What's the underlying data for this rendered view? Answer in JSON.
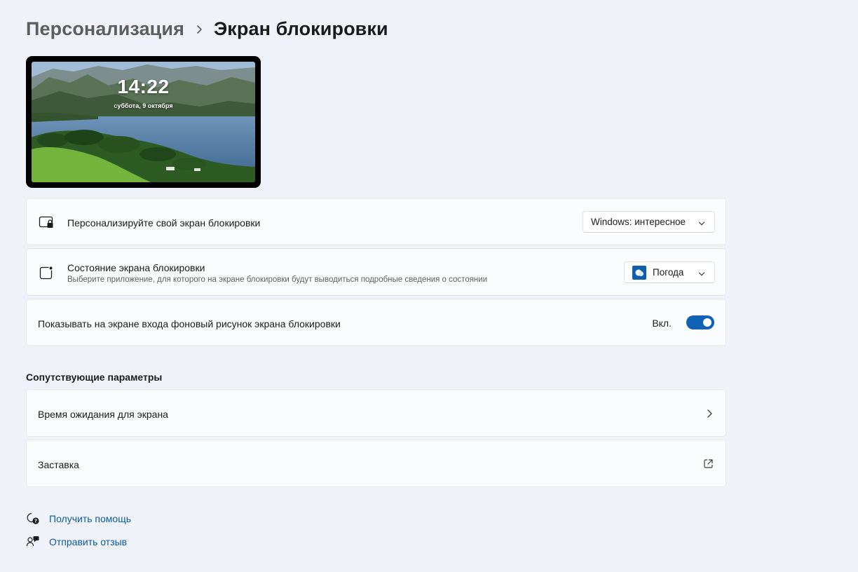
{
  "breadcrumb": {
    "parent": "Персонализация",
    "separator_icon": "chevron-right-icon",
    "current": "Экран блокировки"
  },
  "preview": {
    "time": "14:22",
    "date": "суббота, 9 октября"
  },
  "settings": {
    "personalize": {
      "icon": "lock-screen-icon",
      "title": "Персонализируйте свой экран блокировки",
      "value": "Windows: интересное"
    },
    "status": {
      "icon": "app-status-icon",
      "title": "Состояние экрана блокировки",
      "subtitle": "Выберите приложение, для которого на экране блокировки будут выводиться подробные сведения о состоянии",
      "value": "Погода",
      "value_icon": "weather-app-icon"
    },
    "show_on_signin": {
      "title": "Показывать на экране входа фоновый рисунок экрана блокировки",
      "toggle_label": "Вкл.",
      "on": true
    }
  },
  "related": {
    "heading": "Сопутствующие параметры",
    "items": [
      {
        "label": "Время ожидания для экрана",
        "icon": "chevron-right-icon"
      },
      {
        "label": "Заставка",
        "icon": "open-external-icon"
      }
    ]
  },
  "links": {
    "help": {
      "label": "Получить помощь",
      "icon": "help-icon"
    },
    "feedback": {
      "label": "Отправить отзыв",
      "icon": "feedback-icon"
    }
  },
  "colors": {
    "accent": "#0f62b4",
    "link": "#0b5aa5",
    "background": "#eff3f9"
  }
}
